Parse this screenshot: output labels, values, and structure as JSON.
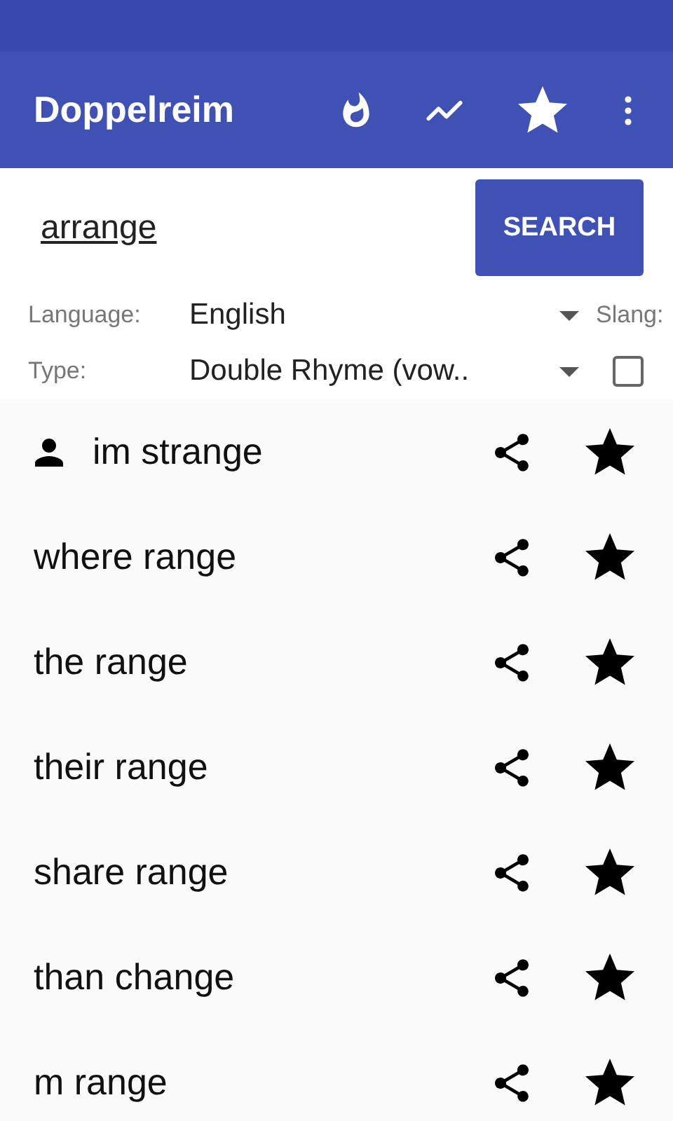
{
  "app_bar": {
    "title": "Doppelreim"
  },
  "search": {
    "value": "arrange",
    "button": "SEARCH"
  },
  "filters": {
    "language_label": "Language:",
    "language": "English",
    "type_label": "Type:",
    "type": "Double Rhyme (vow..",
    "slang_label": "Slang:",
    "slang_checked": false
  },
  "results": [
    {
      "text": "im strange",
      "user": true
    },
    {
      "text": "where range",
      "user": false
    },
    {
      "text": "the range",
      "user": false
    },
    {
      "text": "their range",
      "user": false
    },
    {
      "text": "share range",
      "user": false
    },
    {
      "text": "than change",
      "user": false
    },
    {
      "text": "m range",
      "user": false
    }
  ]
}
